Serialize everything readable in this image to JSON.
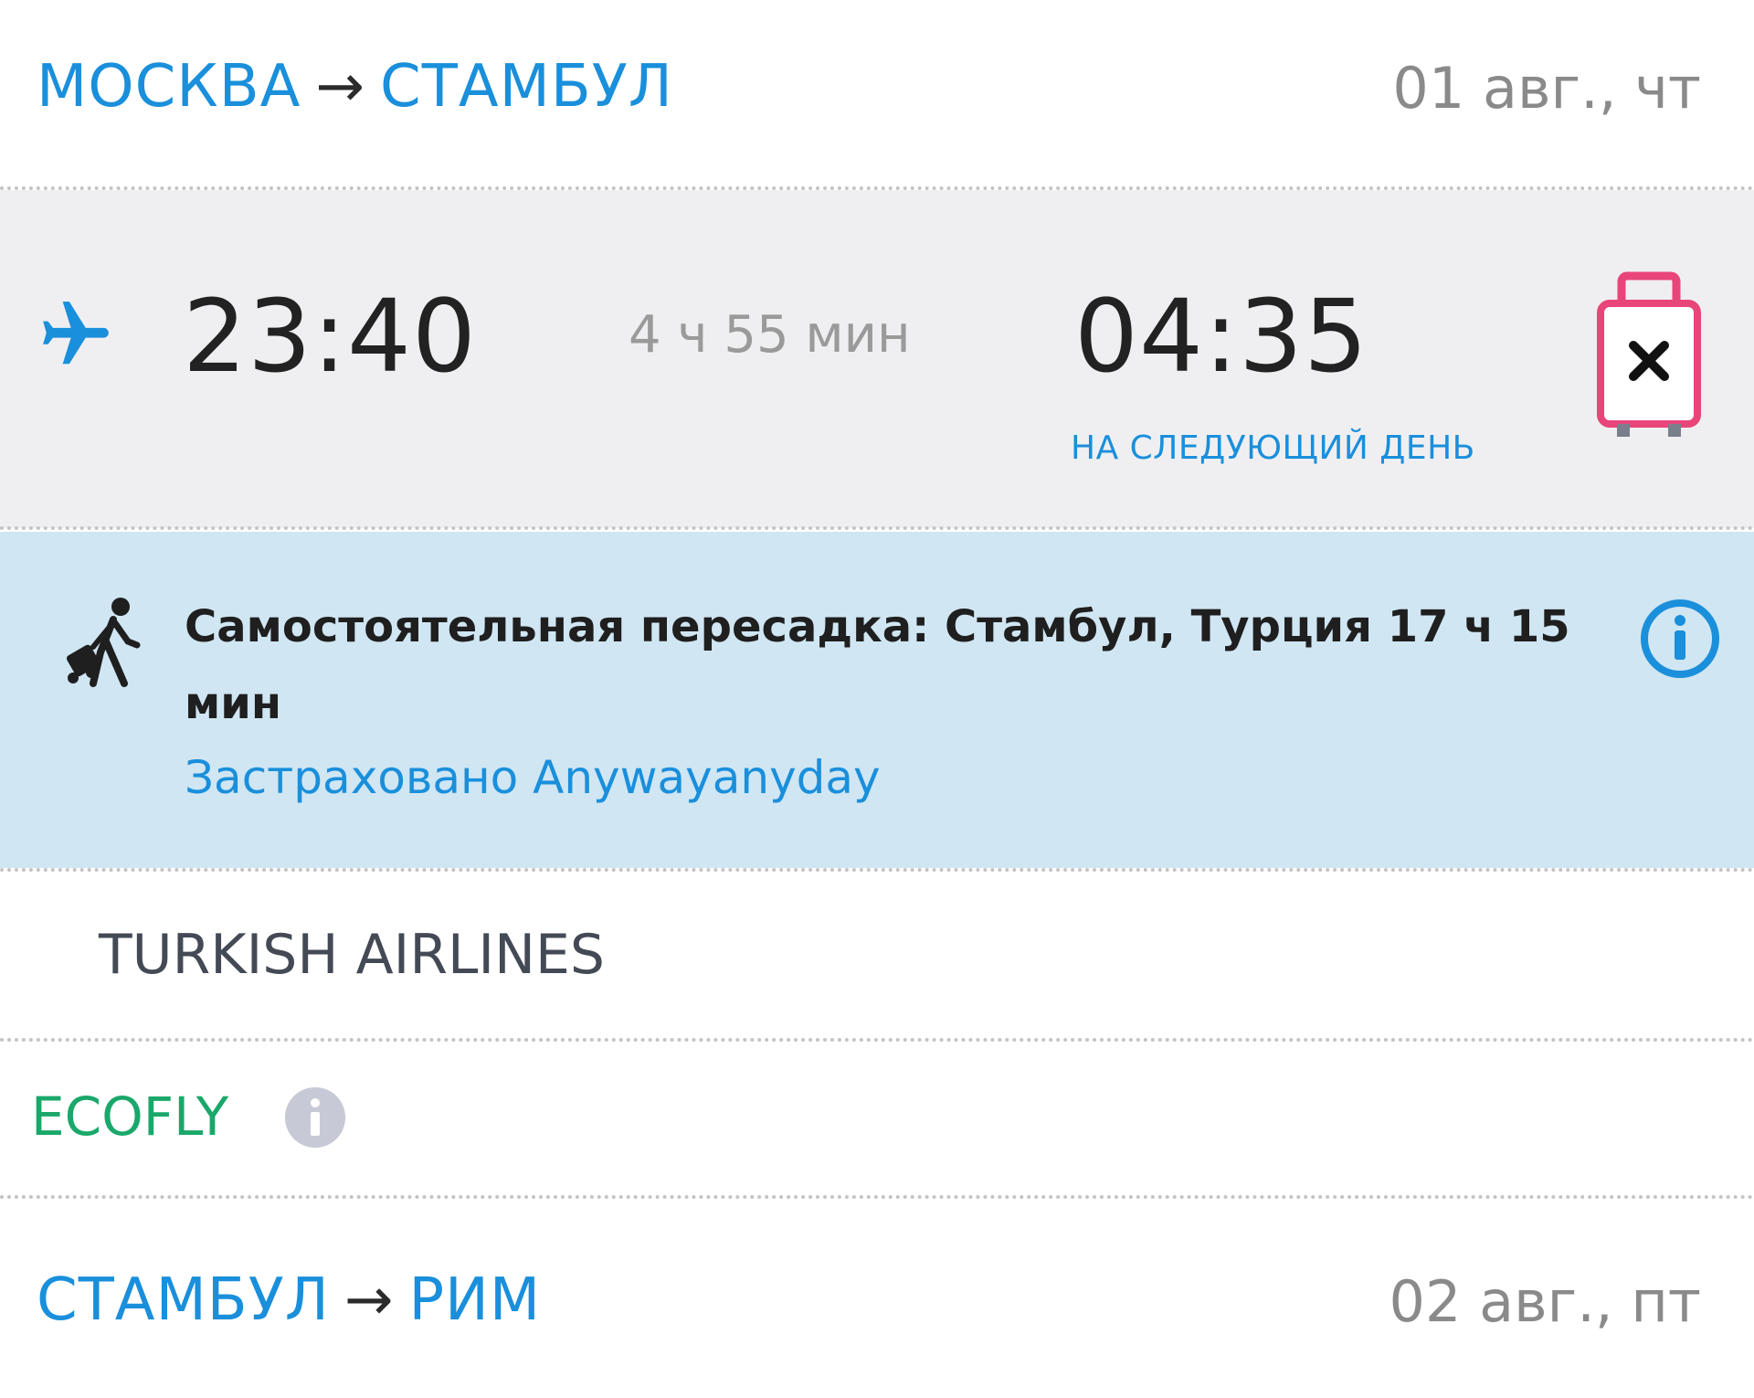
{
  "routes": [
    {
      "from": "МОСКВА",
      "arrow": "→",
      "to": "СТАМБУЛ",
      "date": "01 авг., чт"
    },
    {
      "from": "СТАМБУЛ",
      "arrow": "→",
      "to": "РИМ",
      "date": "02 авг., пт"
    }
  ],
  "segment": {
    "departure_time": "23:40",
    "duration": "4 ч 55 мин",
    "arrival_time": "04:35",
    "next_day_label": "НА СЛЕДУЮЩИЙ ДЕНЬ",
    "baggage_icon": "no-baggage-icon"
  },
  "transfer": {
    "text": "Самостоятельная пересадка: Стамбул, Турция 17 ч 15 мин",
    "insured_label": "Застраховано Anywayanyday"
  },
  "airline": {
    "name": "TURKISH AIRLINES"
  },
  "fare": {
    "name": "ECOFLY"
  },
  "colors": {
    "accent_blue": "#1a8fdb",
    "fare_green": "#1aa86a",
    "baggage_pink": "#e8457a",
    "segment_bg": "#efeff1",
    "transfer_bg": "#d0e6f3"
  }
}
